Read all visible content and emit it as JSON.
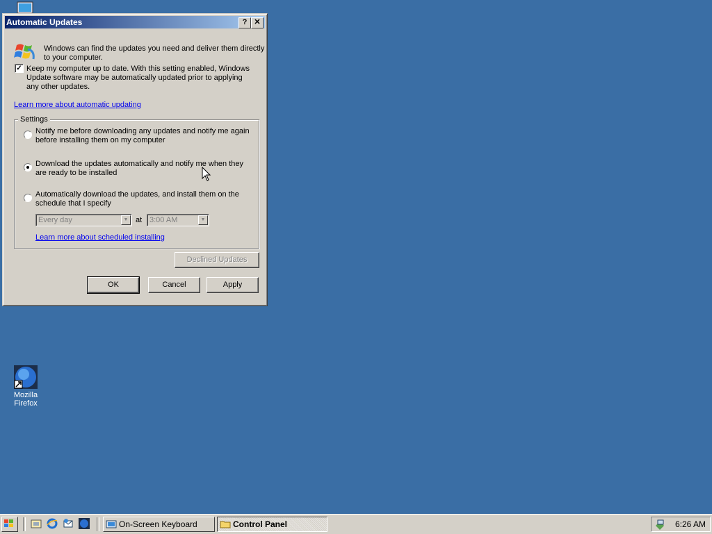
{
  "desktop": {
    "icons": [
      {
        "label": "Mozilla Firefox",
        "icon": "firefox-icon"
      }
    ]
  },
  "dialog": {
    "title": "Automatic Updates",
    "help_label": "?",
    "close_label": "✕",
    "intro_text": "Windows can find the updates you need and deliver them directly to your computer.",
    "keep_uptodate": {
      "checked": true,
      "label": "Keep my computer up to date. With this setting enabled, Windows Update software may be automatically updated prior to applying any other updates."
    },
    "learn_more_link": "Learn more about automatic updating",
    "settings": {
      "group_label": "Settings",
      "options": [
        {
          "label": "Notify me before downloading any updates and notify me again before installing them on my computer",
          "selected": false
        },
        {
          "label": "Download the updates automatically and notify me when they are ready to be installed",
          "selected": true
        },
        {
          "label": "Automatically download the updates, and install them on the schedule that I specify",
          "selected": false
        }
      ],
      "schedule_day": "Every day",
      "at_label": "at",
      "schedule_time": "3:00 AM",
      "scheduled_link": "Learn more about scheduled installing"
    },
    "declined_button": "Declined Updates",
    "ok_button": "OK",
    "cancel_button": "Cancel",
    "apply_button": "Apply"
  },
  "taskbar": {
    "tasks": [
      {
        "label": "On-Screen Keyboard",
        "active": false
      },
      {
        "label": "Control Panel",
        "active": true
      }
    ],
    "clock": "6:26 AM"
  }
}
